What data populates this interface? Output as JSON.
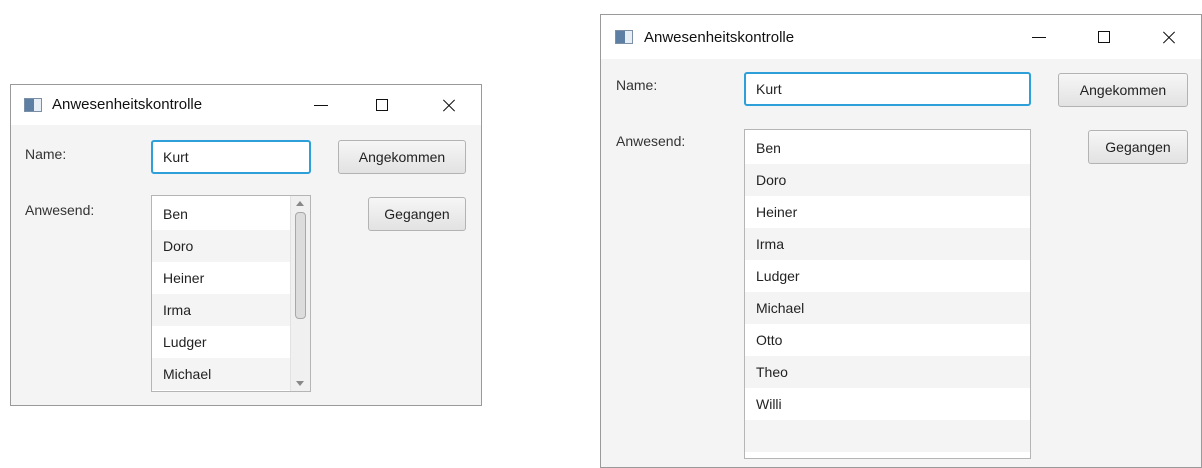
{
  "window_small": {
    "title": "Anwesenheitskontrolle",
    "name_label": "Name:",
    "name_value": "Kurt",
    "present_label": "Anwesend:",
    "arrived_button": "Angekommen",
    "left_button": "Gegangen",
    "attendees": [
      "Ben",
      "Doro",
      "Heiner",
      "Irma",
      "Ludger",
      "Michael"
    ]
  },
  "window_large": {
    "title": "Anwesenheitskontrolle",
    "name_label": "Name:",
    "name_value": "Kurt",
    "present_label": "Anwesend:",
    "arrived_button": "Angekommen",
    "left_button": "Gegangen",
    "attendees": [
      "Ben",
      "Doro",
      "Heiner",
      "Irma",
      "Ludger",
      "Michael",
      "Otto",
      "Theo",
      "Willi",
      ""
    ]
  },
  "colors": {
    "focus_border": "#2d9fd9",
    "window_bg": "#f4f4f4",
    "titlebar_bg": "#ffffff"
  },
  "icons": {
    "app": "java-app-icon",
    "minimize": "minimize-icon",
    "maximize": "maximize-icon",
    "close": "close-icon"
  }
}
